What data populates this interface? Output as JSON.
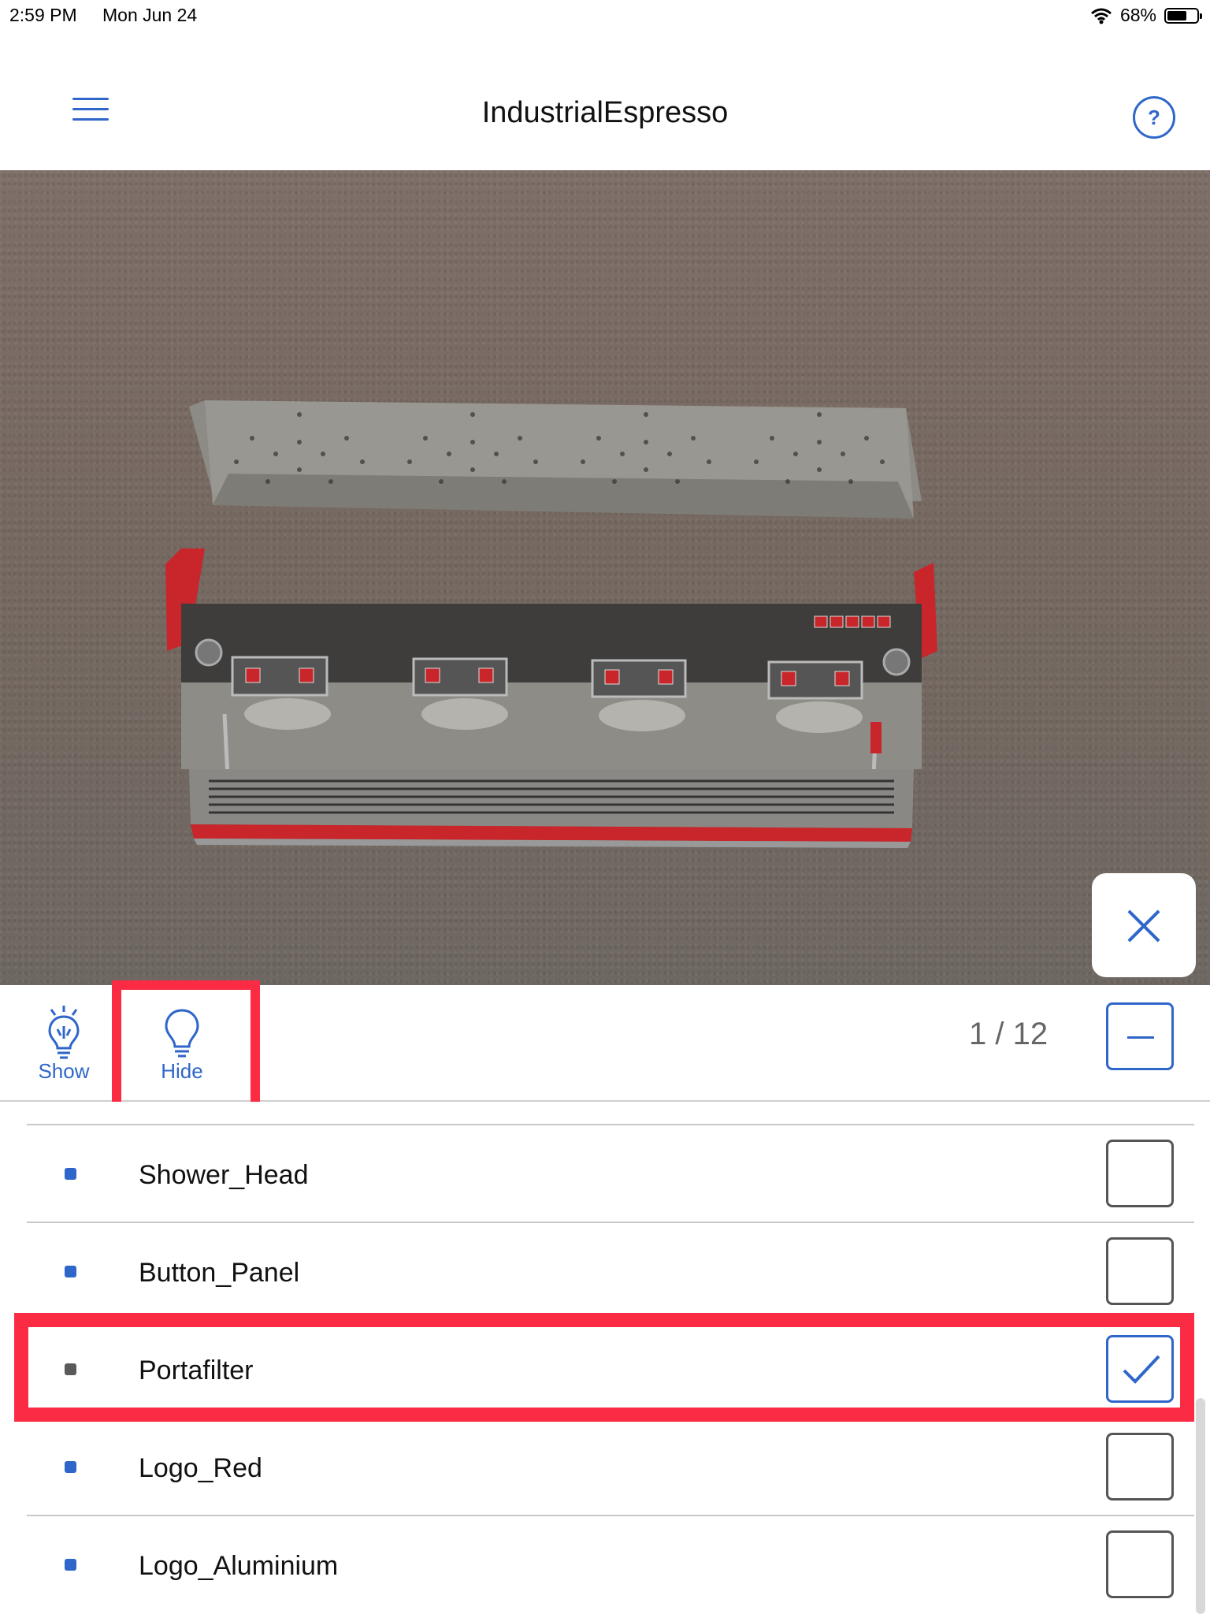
{
  "status": {
    "time": "2:59 PM",
    "date": "Mon Jun 24",
    "battery": "68%",
    "battery_level": 0.68
  },
  "header": {
    "title": "IndustrialEspresso"
  },
  "toolbar": {
    "show_label": "Show",
    "hide_label": "Hide",
    "counter": "1 / 12"
  },
  "parts": [
    {
      "label": "Shower_Head",
      "checked": false
    },
    {
      "label": "Button_Panel",
      "checked": false
    },
    {
      "label": "Portafilter",
      "checked": true
    },
    {
      "label": "Logo_Red",
      "checked": false
    },
    {
      "label": "Logo_Aluminium",
      "checked": false
    }
  ],
  "icons": [
    "menu-icon",
    "help-icon",
    "close-icon",
    "lightbulb-on-icon",
    "lightbulb-off-icon",
    "minus-icon",
    "checkmark-icon",
    "wifi-icon",
    "battery-icon"
  ],
  "colors": {
    "accent": "#2f66c9",
    "highlight": "#fb2b43",
    "machine_red": "#c8262b"
  }
}
